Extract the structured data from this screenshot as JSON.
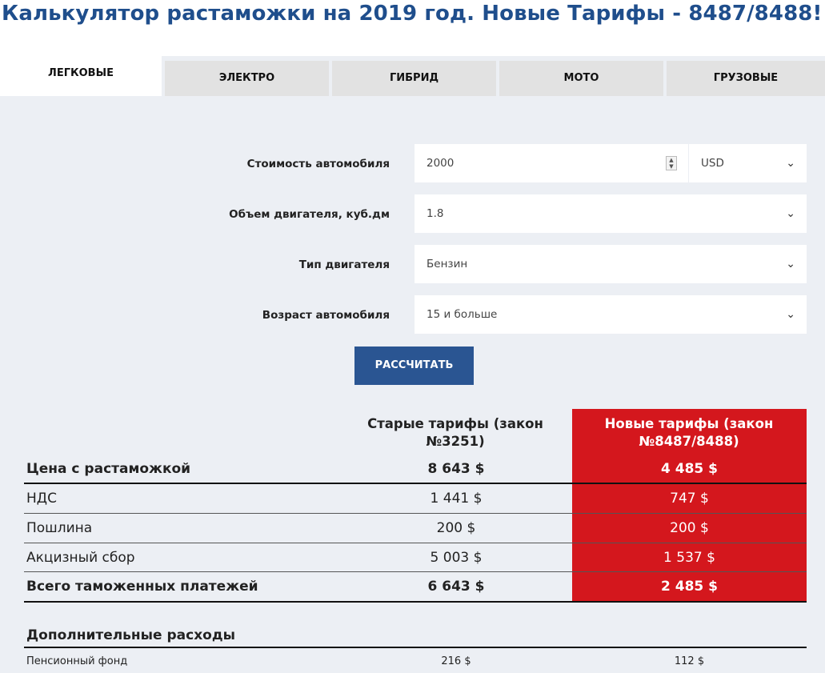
{
  "title": "Калькулятор растаможки на 2019 год. Новые Тарифы - 8487/8488!",
  "tabs": [
    {
      "label": "ЛЕГКОВЫЕ",
      "active": true
    },
    {
      "label": "ЭЛЕКТРО",
      "active": false
    },
    {
      "label": "ГИБРИД",
      "active": false
    },
    {
      "label": "МОТО",
      "active": false
    },
    {
      "label": "ГРУЗОВЫЕ",
      "active": false
    }
  ],
  "form": {
    "price_label": "Стоимость автомобиля",
    "price_value": "2000",
    "currency": "USD",
    "engine_volume_label": "Объем двигателя, куб.дм",
    "engine_volume_value": "1.8",
    "engine_type_label": "Тип двигателя",
    "engine_type_value": "Бензин",
    "age_label": "Возраст автомобиля",
    "age_value": "15 и больше",
    "calc_button": "РАССЧИТАТЬ"
  },
  "results": {
    "old_header": "Старые тарифы (закон №3251)",
    "new_header": "Новые тарифы (закон №8487/8488)",
    "rows": [
      {
        "label": "Цена с растаможкой",
        "old": "8 643 $",
        "new": "4 485 $"
      },
      {
        "label": "НДС",
        "old": "1 441 $",
        "new": "747 $"
      },
      {
        "label": "Пошлина",
        "old": "200 $",
        "new": "200 $"
      },
      {
        "label": "Акцизный сбор",
        "old": "5 003 $",
        "new": "1 537 $"
      },
      {
        "label": "Всего таможенных платежей",
        "old": "6 643 $",
        "new": "2 485 $"
      }
    ]
  },
  "extra": {
    "title": "Дополнительные расходы",
    "pension_label": "Пенсионный фонд",
    "pension_old": "216 $",
    "pension_new": "112 $"
  },
  "colors": {
    "title": "#1f4e8c",
    "button": "#2a5592",
    "new_tariff_bg": "#d4171d",
    "panel_bg": "#eceff4"
  },
  "icons": {
    "dropdown": "chevron-down-icon",
    "spinner": "number-spinner-icon"
  }
}
